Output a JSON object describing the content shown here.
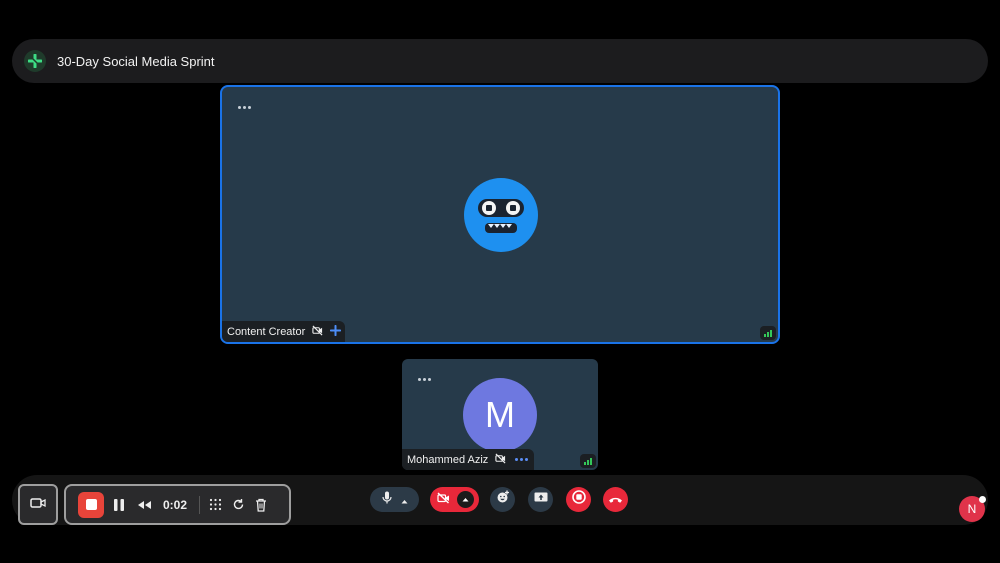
{
  "meeting": {
    "title": "30-Day Social Media Sprint",
    "logo_icon": "green-plus-logo-icon"
  },
  "participants": [
    {
      "name": "Content Creator",
      "avatar": "robot-avatar",
      "camera": "off",
      "pinned": true,
      "speaking": true
    },
    {
      "name": "Mohammed Aziz",
      "avatar_initial": "M",
      "avatar_color": "#6e78e0",
      "camera": "off"
    }
  ],
  "recorder": {
    "elapsed": "0:02",
    "controls": [
      "stop-recording",
      "pause",
      "rewind",
      "grid",
      "restart",
      "delete"
    ]
  },
  "controls": {
    "items": [
      "microphone",
      "microphone-options",
      "camera-off",
      "camera-options",
      "reactions",
      "present",
      "record",
      "leave-call"
    ]
  },
  "user": {
    "initial": "N",
    "color": "#e0334a"
  },
  "colors": {
    "accent": "#1a73e8",
    "danger": "#e8283a",
    "tile": "#263a4a",
    "success": "#34c759"
  }
}
